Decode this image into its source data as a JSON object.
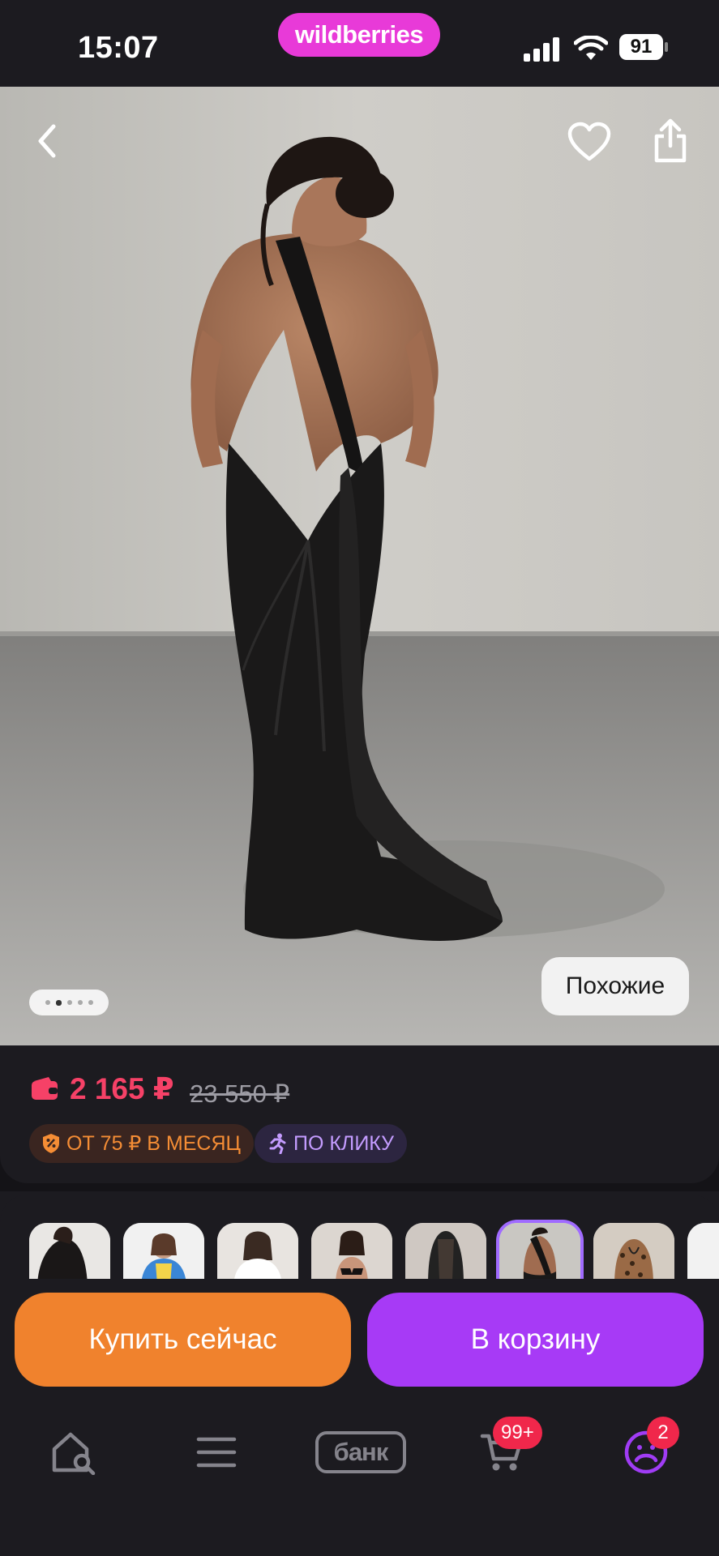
{
  "status_bar": {
    "time": "15:07",
    "brand": "wildberries",
    "battery": "91"
  },
  "product": {
    "similar_label": "Похожие",
    "gallery_index": 2,
    "gallery_count": 5
  },
  "price": {
    "current": "2 165 ₽",
    "old": "23 550 ₽",
    "installment": "ОТ 75 ₽ В МЕСЯЦ",
    "one_click": "ПО КЛИКУ",
    "accent_color": "#f64167"
  },
  "thumbnails": [
    {
      "name": "variant-1",
      "selected": false
    },
    {
      "name": "variant-2",
      "selected": false
    },
    {
      "name": "variant-3",
      "selected": false
    },
    {
      "name": "variant-4",
      "selected": false
    },
    {
      "name": "variant-5",
      "selected": false
    },
    {
      "name": "variant-6",
      "selected": true
    },
    {
      "name": "variant-7",
      "selected": false
    },
    {
      "name": "variant-8",
      "selected": false
    }
  ],
  "actions": {
    "buy_now": "Купить сейчас",
    "add_to_cart": "В корзину",
    "buy_color": "#f0822d",
    "cart_color": "#a73af6"
  },
  "bottom_nav": {
    "home_icon": "home-search-icon",
    "catalog_icon": "menu-icon",
    "bank_label": "банк",
    "cart_badge": "99+",
    "profile_badge": "2"
  }
}
